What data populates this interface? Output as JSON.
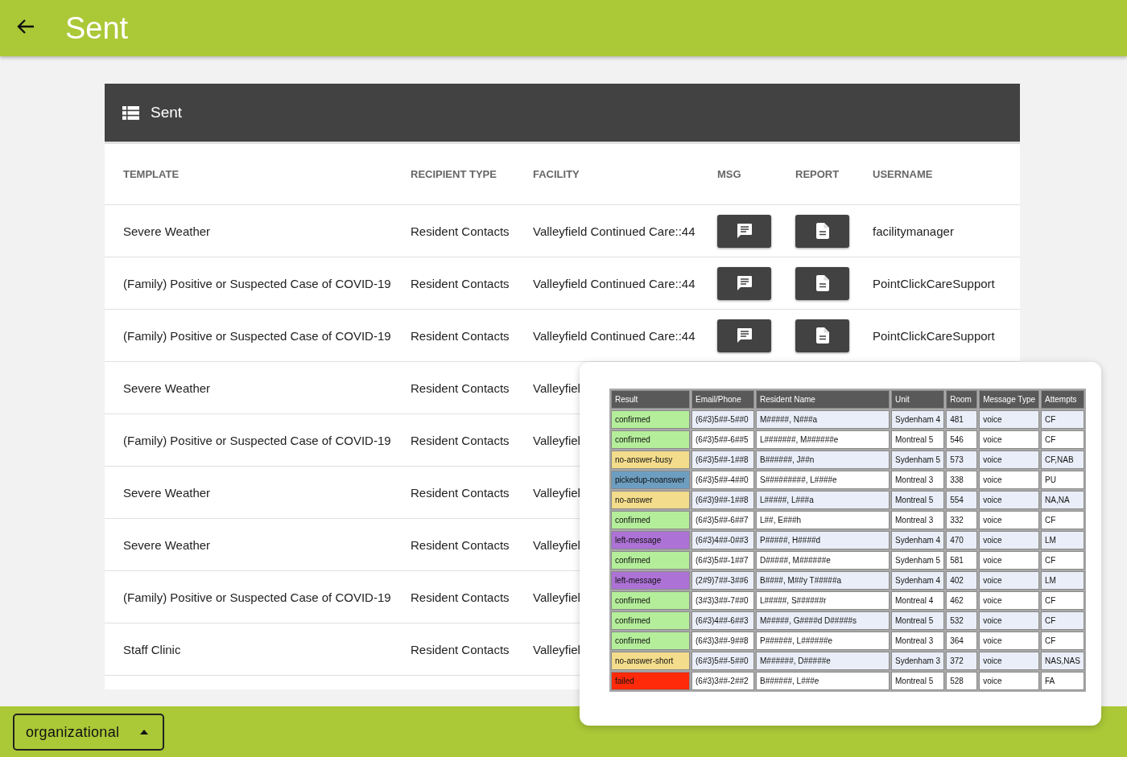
{
  "app_bar": {
    "title": "Sent"
  },
  "card": {
    "title": "Sent",
    "columns": [
      "TEMPLATE",
      "RECIPIENT TYPE",
      "FACILITY",
      "MSG",
      "REPORT",
      "USERNAME"
    ],
    "rows": [
      {
        "template": "Severe Weather",
        "recipient_type": "Resident Contacts",
        "facility": "Valleyfield Continued Care::44",
        "username": "facilitymanager"
      },
      {
        "template": "(Family) Positive or Suspected Case of COVID-19",
        "recipient_type": "Resident Contacts",
        "facility": "Valleyfield Continued Care::44",
        "username": "PointClickCareSupport"
      },
      {
        "template": "(Family) Positive or Suspected Case of COVID-19",
        "recipient_type": "Resident Contacts",
        "facility": "Valleyfield Continued Care::44",
        "username": "PointClickCareSupport"
      },
      {
        "template": "Severe Weather",
        "recipient_type": "Resident Contacts",
        "facility": "Valleyfiel"
      },
      {
        "template": "(Family) Positive or Suspected Case of COVID-19",
        "recipient_type": "Resident Contacts",
        "facility": "Valleyfiel"
      },
      {
        "template": "Severe Weather",
        "recipient_type": "Resident Contacts",
        "facility": "Valleyfiel"
      },
      {
        "template": "Severe Weather",
        "recipient_type": "Resident Contacts",
        "facility": "Valleyfiel"
      },
      {
        "template": "(Family) Positive or Suspected Case of COVID-19",
        "recipient_type": "Resident Contacts",
        "facility": "Valleyfiel"
      },
      {
        "template": "Staff Clinic",
        "recipient_type": "Resident Contacts",
        "facility": "Valleyfiel"
      }
    ]
  },
  "report_preview": {
    "columns": [
      "Result",
      "Email/Phone",
      "Resident Name",
      "Unit",
      "Room",
      "Message Type",
      "Attempts"
    ],
    "rows": [
      {
        "result": "confirmed",
        "color": "#b4ee9a",
        "contact": "(6#3)5##-5##0",
        "name": "M#####, N###a",
        "unit": "Sydenham 4",
        "room": "481",
        "message_type": "voice",
        "attempts": "CF"
      },
      {
        "result": "confirmed",
        "color": "#b4ee9a",
        "contact": "(6#3)5##-6##5",
        "name": "L#######, M######e",
        "unit": "Montreal 5",
        "room": "546",
        "message_type": "voice",
        "attempts": "CF"
      },
      {
        "result": "no-answer-busy",
        "color": "#f3dc8c",
        "contact": "(6#3)5##-1##8",
        "name": "B######, J##n",
        "unit": "Sydenham 5",
        "room": "573",
        "message_type": "voice",
        "attempts": "CF,NAB"
      },
      {
        "result": "pickedup-noanswer",
        "color": "#6d9ec0",
        "contact": "(6#3)5##-4##0",
        "name": "S#########, L####e",
        "unit": "Montreal 3",
        "room": "338",
        "message_type": "voice",
        "attempts": "PU"
      },
      {
        "result": "no-answer",
        "color": "#f3dc8c",
        "contact": "(6#3)9##-1##8",
        "name": "L#####, L###a",
        "unit": "Montreal 5",
        "room": "554",
        "message_type": "voice",
        "attempts": "NA,NA"
      },
      {
        "result": "confirmed",
        "color": "#b4ee9a",
        "contact": "(6#3)5##-6##7",
        "name": "L##, E###h",
        "unit": "Montreal 3",
        "room": "332",
        "message_type": "voice",
        "attempts": "CF"
      },
      {
        "result": "left-message",
        "color": "#ad72d6",
        "contact": "(6#3)4##-0##3",
        "name": "P#####, H####d",
        "unit": "Sydenham 4",
        "room": "470",
        "message_type": "voice",
        "attempts": "LM"
      },
      {
        "result": "confirmed",
        "color": "#b4ee9a",
        "contact": "(6#3)5##-1##7",
        "name": "D#####, M######e",
        "unit": "Sydenham 5",
        "room": "581",
        "message_type": "voice",
        "attempts": "CF"
      },
      {
        "result": "left-message",
        "color": "#ad72d6",
        "contact": "(2#9)7##-3##6",
        "name": "B####, M##y T#####a",
        "unit": "Sydenham 4",
        "room": "402",
        "message_type": "voice",
        "attempts": "LM"
      },
      {
        "result": "confirmed",
        "color": "#b4ee9a",
        "contact": "(3#3)3##-7##0",
        "name": "L#####, S######r",
        "unit": "Montreal 4",
        "room": "462",
        "message_type": "voice",
        "attempts": "CF"
      },
      {
        "result": "confirmed",
        "color": "#b4ee9a",
        "contact": "(6#3)4##-6##3",
        "name": "M#####, G####d D#####s",
        "unit": "Montreal 5",
        "room": "532",
        "message_type": "voice",
        "attempts": "CF"
      },
      {
        "result": "confirmed",
        "color": "#b4ee9a",
        "contact": "(6#3)3##-9##8",
        "name": "P######, L######e",
        "unit": "Montreal 3",
        "room": "364",
        "message_type": "voice",
        "attempts": "CF"
      },
      {
        "result": "no-answer-short",
        "color": "#f3dc8c",
        "contact": "(6#3)5##-5##0",
        "name": "M######, D#####e",
        "unit": "Sydenham 3",
        "room": "372",
        "message_type": "voice",
        "attempts": "NAS,NAS"
      },
      {
        "result": "failed",
        "color": "#ff2a0a",
        "contact": "(6#3)3##-2##2",
        "name": "B######, L###e",
        "unit": "Montreal 5",
        "room": "528",
        "message_type": "voice",
        "attempts": "FA"
      }
    ]
  },
  "footer": {
    "dropdown": {
      "value": "organizational"
    }
  }
}
